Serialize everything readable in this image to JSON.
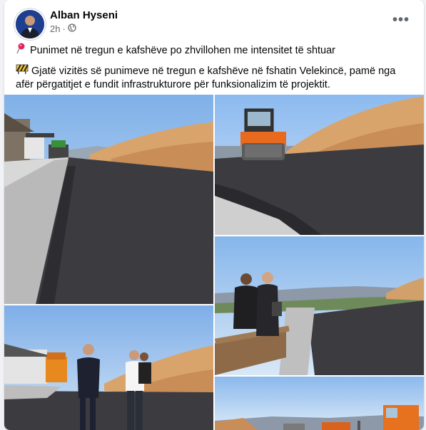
{
  "post": {
    "author": "Alban Hyseni",
    "time": "2h",
    "dot": "·",
    "more_label": "•••",
    "line1": "Punimet në tregun e kafshëve po zhvillohen me intensitet të shtuar",
    "line2": "Gjatë vizitës së punimeve në tregun e kafshëve në fshatin Velekincë, pamë nga afër përgatitjet e fundit infrastrukturore për funksionalizim të projektit.",
    "emoji1": "round-pushpin-icon",
    "emoji2": "construction-sign-icon",
    "privacy_icon": "globe-icon"
  },
  "photos": [
    {
      "name": "photo-road-paver"
    },
    {
      "name": "photo-road-roller"
    },
    {
      "name": "photo-inspection-group"
    },
    {
      "name": "photo-officials-walking"
    },
    {
      "name": "photo-trucks"
    }
  ],
  "colors": {
    "text": "#050505",
    "secondary": "#65676b",
    "asphalt": "#3c3c40",
    "sky": "#8fb8e6",
    "hill": "#d9a46b"
  }
}
